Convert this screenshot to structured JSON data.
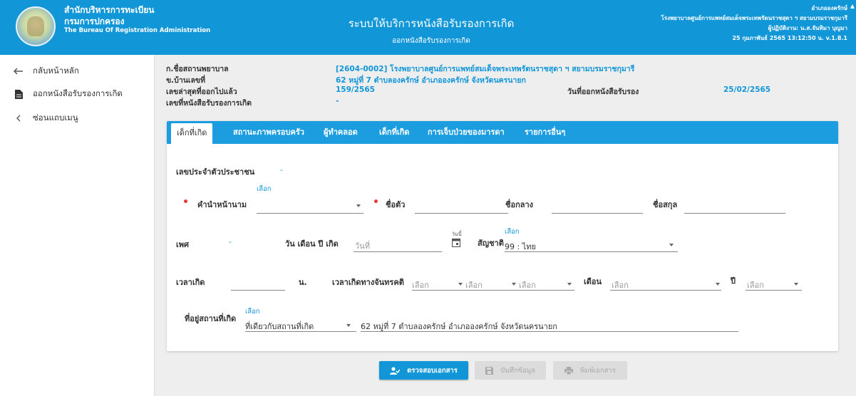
{
  "header": {
    "org_th_1": "สำนักบริหารการทะเบียน",
    "org_th_2": "กรมการปกครอง",
    "org_en": "The Bureau Of Registration Administration",
    "system_title": "ระบบให้บริการหนังสือรับรองการเกิด",
    "system_subtitle": "ออกหนังสือรับรองการเกิด",
    "user_district": "อำเภอองครักษ์",
    "user_hospital": "โรงพยาบาลศูนย์การแพทย์สมเด็จพระเทพรัตนราชสุดา ฯ สยามบรมราชกุมารี",
    "user_name": "ผู้ปฏิบัติงาน: น.ส.จันทิมา บุญมา",
    "user_datetime": "25 กุมภาพันธ์ 2565 13:12:50 น.  v.1.8.1"
  },
  "sidebar": {
    "items": [
      {
        "label": "กลับหน้าหลัก",
        "icon": "back-arrow-icon"
      },
      {
        "label": "ออกหนังสือรับรองการเกิด",
        "icon": "document-icon"
      },
      {
        "label": "ซ่อนแถบเมนู",
        "icon": "chevron-left-icon"
      }
    ]
  },
  "summary": {
    "hospital_label": "ก.ชื่อสถานพยาบาล",
    "hospital_value": "[2604-0002] โรงพยาบาลศูนย์การแพทย์สมเด็จพระเทพรัตนราชสุดา ฯ สยามบรมราชกุมารี",
    "address_label": "ข.บ้านเลขที่",
    "address_value": "62 หมู่ที่ 7 ตำบลองครักษ์ อำเภอองครักษ์ จังหวัดนครนายก",
    "latest_label": "เลขล่าสุดที่ออกไปแล้ว",
    "latest_value": "159/2565",
    "cert_no_label": "เลขที่หนังสือรับรองการเกิด",
    "cert_no_value": "-",
    "issue_date_label": "วันที่ออกหนังสือรับรอง",
    "issue_date_value": "25/02/2565"
  },
  "tabs": [
    {
      "label": "เด็กที่เกิด",
      "active": true
    },
    {
      "label": "สถานะภาพครอบครัว",
      "active": false
    },
    {
      "label": "ผู้ทำคลอด",
      "active": false
    },
    {
      "label": "เด็กที่เกิด",
      "active": false
    },
    {
      "label": "การเจ็บป่วยของมารดา",
      "active": false
    },
    {
      "label": "รายการอื่นๆ",
      "active": false
    }
  ],
  "form": {
    "id_label": "เลขประจำตัวประชาชน",
    "id_value": "-",
    "prefix_label": "คำนำหน้านาม",
    "prefix_select_label": "เลือก",
    "firstname_label": "ชื่อตัว",
    "middlename_label": "ชื่อกลาง",
    "lastname_label": "ชื่อสกุล",
    "sex_label": "เพศ",
    "sex_value": "-",
    "dob_label": "วัน เดือน ปี เกิด",
    "dob_placeholder": "วันที่",
    "calendar_label": "วันนี้",
    "nationality_label": "สัญชาติ",
    "nationality_select_label": "เลือก",
    "nationality_value": "99 : ไทย",
    "birth_time_label": "เวลาเกิด",
    "birth_time_unit": "น.",
    "lunar_time_label": "เวลาเกิดทางจันทรคติ",
    "lunar_1_placeholder": "เลือก",
    "lunar_2_placeholder": "เลือก",
    "lunar_3_placeholder": "เลือก",
    "month_label": "เดือน",
    "month_placeholder": "เลือก",
    "year_label": "ปี",
    "year_placeholder": "เลือก",
    "birthplace_label": "ที่อยู่สถานที่เกิด",
    "birthplace_select_label": "เลือก",
    "birthplace_select_value": "ที่เดียวกับสถานที่เกิด",
    "birthplace_address": "62 หมู่ที่ 7 ตำบลองครักษ์ อำเภอองครักษ์ จังหวัดนครนายก"
  },
  "buttons": {
    "check": "ตรวจสอบเอกสาร",
    "save": "บันทึกข้อมูล",
    "print": "พิมพ์เอกสาร"
  },
  "colors": {
    "primary": "#1196d8",
    "tabbar": "#1c9de0",
    "required": "#e53935"
  }
}
